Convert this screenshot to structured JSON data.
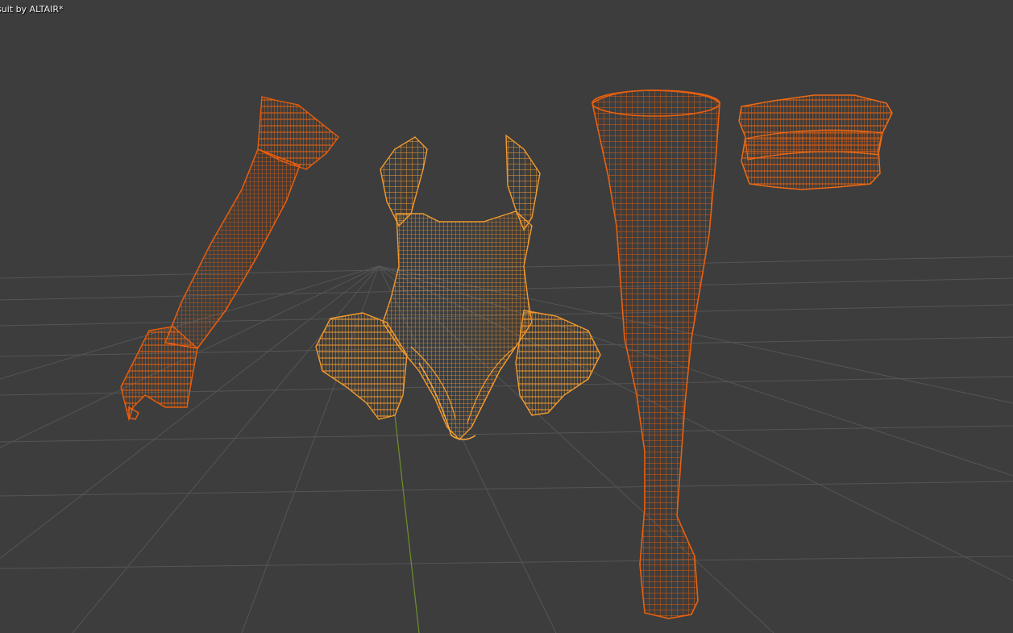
{
  "viewport": {
    "overlay_text": "suit by ALTAIR*",
    "background_color": "#3d3d3d",
    "grid_color": "#545454",
    "y_axis_color": "#6e8f2a",
    "mode": "wireframe"
  },
  "objects": [
    {
      "name": "sleeve",
      "color": "#e85e0c"
    },
    {
      "name": "bodysuit",
      "color": "#f29a2e"
    },
    {
      "name": "stocking",
      "color": "#e8600f"
    },
    {
      "name": "garter",
      "color": "#ee6a15"
    }
  ]
}
